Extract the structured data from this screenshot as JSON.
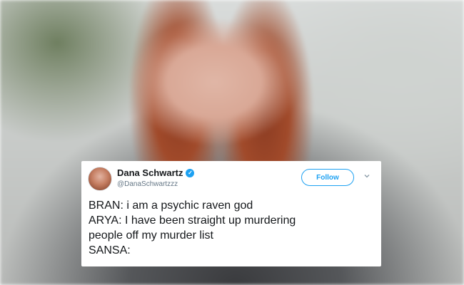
{
  "tweet": {
    "display_name": "Dana Schwartz",
    "handle": "@DanaSchwartzzz",
    "follow_label": "Follow",
    "lines": [
      "BRAN: i am a psychic raven god",
      "ARYA: I have been straight up murdering",
      "people off my murder list",
      "SANSA:"
    ]
  },
  "colors": {
    "accent": "#1da1f2",
    "text": "#14171a",
    "muted": "#657786"
  },
  "icons": {
    "verified": "verified-badge-icon",
    "menu": "chevron-down-icon"
  }
}
